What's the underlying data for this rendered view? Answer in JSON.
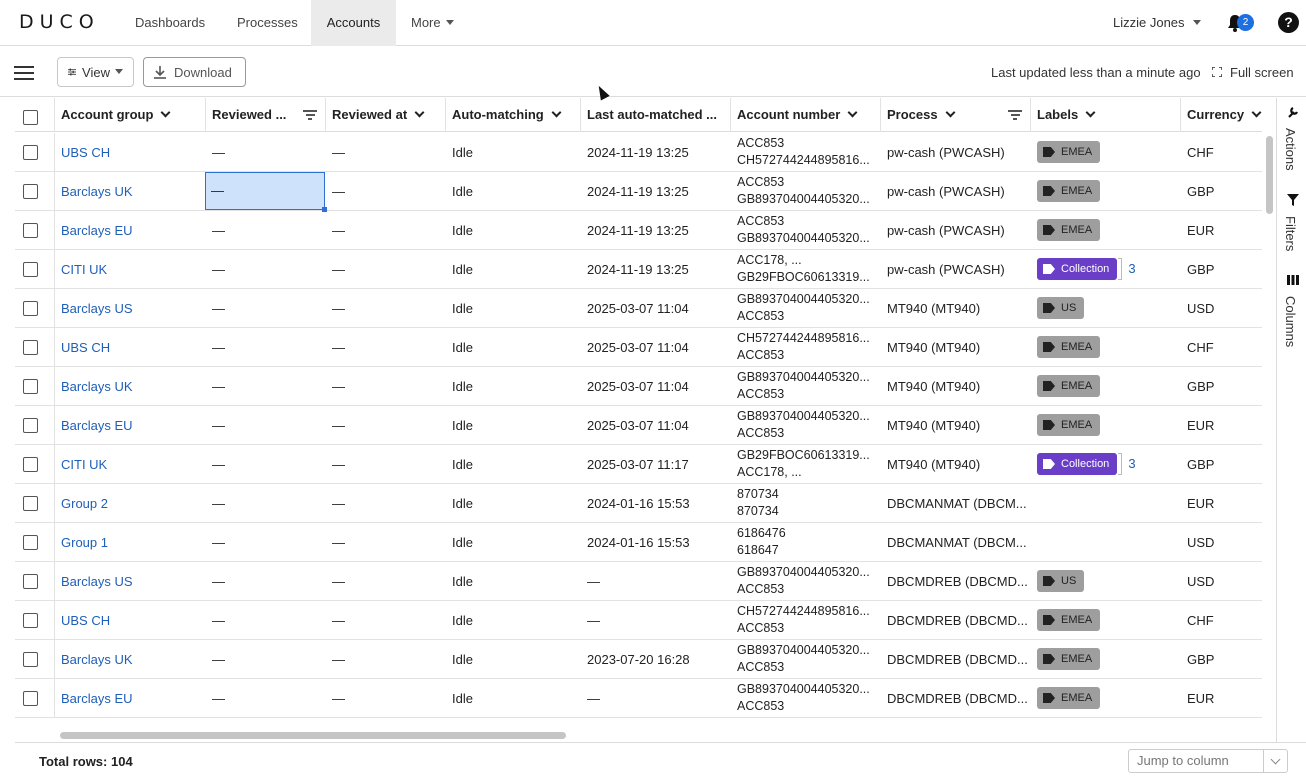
{
  "app": {
    "logo": "DUCO",
    "nav": [
      "Dashboards",
      "Processes",
      "Accounts",
      "More"
    ],
    "active_nav": "Accounts",
    "user": "Lizzie Jones",
    "notifications": "2",
    "help": "?"
  },
  "toolbar": {
    "view_label": "View",
    "download_label": "Download",
    "last_updated": "Last updated less than a minute ago",
    "fullscreen_label": "Full screen"
  },
  "columns": [
    "Account group",
    "Reviewed ...",
    "Reviewed at",
    "Auto-matching",
    "Last auto-matched ...",
    "Account number",
    "Process",
    "Labels",
    "Currency"
  ],
  "rows": [
    {
      "group": "UBS CH",
      "reviewed": "—",
      "reviewed_at": "—",
      "auto": "Idle",
      "last": "2024-11-19 13:25",
      "acc1": "ACC853",
      "acc2": "CH572744244895816...",
      "process": "pw-cash (PWCASH)",
      "label": "EMEA",
      "currency": "CHF"
    },
    {
      "group": "Barclays UK",
      "reviewed": "—",
      "reviewed_at": "—",
      "auto": "Idle",
      "last": "2024-11-19 13:25",
      "acc1": "ACC853",
      "acc2": "GB893704004405320...",
      "process": "pw-cash (PWCASH)",
      "label": "EMEA",
      "currency": "GBP"
    },
    {
      "group": "Barclays EU",
      "reviewed": "—",
      "reviewed_at": "—",
      "auto": "Idle",
      "last": "2024-11-19 13:25",
      "acc1": "ACC853",
      "acc2": "GB893704004405320...",
      "process": "pw-cash (PWCASH)",
      "label": "EMEA",
      "currency": "EUR"
    },
    {
      "group": "CITI UK",
      "reviewed": "—",
      "reviewed_at": "—",
      "auto": "Idle",
      "last": "2024-11-19 13:25",
      "acc1": "ACC178, ...",
      "acc2": "GB29FBOC60613319...",
      "process": "pw-cash (PWCASH)",
      "label": "Collection",
      "label_more": "3",
      "currency": "GBP"
    },
    {
      "group": "Barclays US",
      "reviewed": "—",
      "reviewed_at": "—",
      "auto": "Idle",
      "last": "2025-03-07 11:04",
      "acc1": "GB893704004405320...",
      "acc2": "ACC853",
      "process": "MT940 (MT940)",
      "label": "US",
      "currency": "USD"
    },
    {
      "group": "UBS CH",
      "reviewed": "—",
      "reviewed_at": "—",
      "auto": "Idle",
      "last": "2025-03-07 11:04",
      "acc1": "CH572744244895816...",
      "acc2": "ACC853",
      "process": "MT940 (MT940)",
      "label": "EMEA",
      "currency": "CHF"
    },
    {
      "group": "Barclays UK",
      "reviewed": "—",
      "reviewed_at": "—",
      "auto": "Idle",
      "last": "2025-03-07 11:04",
      "acc1": "GB893704004405320...",
      "acc2": "ACC853",
      "process": "MT940 (MT940)",
      "label": "EMEA",
      "currency": "GBP"
    },
    {
      "group": "Barclays EU",
      "reviewed": "—",
      "reviewed_at": "—",
      "auto": "Idle",
      "last": "2025-03-07 11:04",
      "acc1": "GB893704004405320...",
      "acc2": "ACC853",
      "process": "MT940 (MT940)",
      "label": "EMEA",
      "currency": "EUR"
    },
    {
      "group": "CITI UK",
      "reviewed": "—",
      "reviewed_at": "—",
      "auto": "Idle",
      "last": "2025-03-07 11:17",
      "acc1": "GB29FBOC60613319...",
      "acc2": "ACC178, ...",
      "process": "MT940 (MT940)",
      "label": "Collection",
      "label_more": "3",
      "currency": "GBP"
    },
    {
      "group": "Group 2",
      "reviewed": "—",
      "reviewed_at": "—",
      "auto": "Idle",
      "last": "2024-01-16 15:53",
      "acc1": "870734",
      "acc2": "870734",
      "process": "DBCMANMAT (DBCM...",
      "label": "",
      "currency": "EUR"
    },
    {
      "group": "Group 1",
      "reviewed": "—",
      "reviewed_at": "—",
      "auto": "Idle",
      "last": "2024-01-16 15:53",
      "acc1": "6186476",
      "acc2": "618647",
      "process": "DBCMANMAT (DBCM...",
      "label": "",
      "currency": "USD"
    },
    {
      "group": "Barclays US",
      "reviewed": "—",
      "reviewed_at": "—",
      "auto": "Idle",
      "last": "—",
      "acc1": "GB893704004405320...",
      "acc2": "ACC853",
      "process": "DBCMDREB (DBCMD...",
      "label": "US",
      "currency": "USD"
    },
    {
      "group": "UBS CH",
      "reviewed": "—",
      "reviewed_at": "—",
      "auto": "Idle",
      "last": "—",
      "acc1": "CH572744244895816...",
      "acc2": "ACC853",
      "process": "DBCMDREB (DBCMD...",
      "label": "EMEA",
      "currency": "CHF"
    },
    {
      "group": "Barclays UK",
      "reviewed": "—",
      "reviewed_at": "—",
      "auto": "Idle",
      "last": "2023-07-20 16:28",
      "acc1": "GB893704004405320...",
      "acc2": "ACC853",
      "process": "DBCMDREB (DBCMD...",
      "label": "EMEA",
      "currency": "GBP"
    },
    {
      "group": "Barclays EU",
      "reviewed": "—",
      "reviewed_at": "—",
      "auto": "Idle",
      "last": "—",
      "acc1": "GB893704004405320...",
      "acc2": "ACC853",
      "process": "DBCMDREB (DBCMD...",
      "label": "EMEA",
      "currency": "EUR"
    }
  ],
  "side_panel": [
    "Actions",
    "Filters",
    "Columns"
  ],
  "footer": {
    "total_rows": "Total rows: 104",
    "jump_placeholder": "Jump to column"
  }
}
